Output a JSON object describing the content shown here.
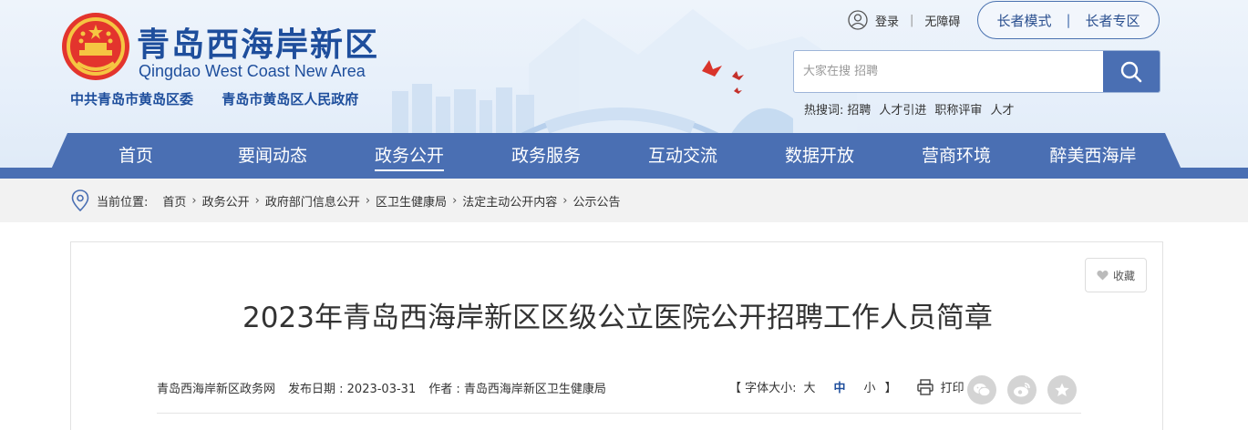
{
  "header": {
    "title": "青岛西海岸新区",
    "subtitle": "Qingdao West Coast New Area",
    "orgs": [
      "中共青岛市黄岛区委",
      "青岛市黄岛区人民政府"
    ],
    "login": "登录",
    "accessible": "无障碍",
    "elder_mode": "长者模式",
    "elder_zone": "长者专区"
  },
  "search": {
    "placeholder": "大家在搜 招聘",
    "hot_label": "热搜词:",
    "hot_words": [
      "招聘",
      "人才引进",
      "职称评审",
      "人才"
    ]
  },
  "nav": {
    "items": [
      "首页",
      "要闻动态",
      "政务公开",
      "政务服务",
      "互动交流",
      "数据开放",
      "营商环境",
      "醉美西海岸"
    ],
    "active": "政务公开"
  },
  "breadcrumb": {
    "label": "当前位置:",
    "items": [
      "首页",
      "政务公开",
      "政府部门信息公开",
      "区卫生健康局",
      "法定主动公开内容",
      "公示公告"
    ],
    "sep": "›"
  },
  "article": {
    "favorite": "收藏",
    "title": "2023年青岛西海岸新区区级公立医院公开招聘工作人员简章",
    "source": "青岛西海岸新区政务网",
    "date": "发布日期 : 2023-03-31",
    "author": "作者 : 青岛西海岸新区卫生健康局",
    "font_label": "【 字体大小:",
    "font_sizes": [
      "大",
      "中",
      "小"
    ],
    "font_close": "】",
    "print": "打印"
  },
  "colors": {
    "brand": "#1e4e9c",
    "nav": "#4a6fb3",
    "crumb_bg": "#f2f2f2"
  },
  "icons": [
    "emblem",
    "user-icon",
    "search-icon",
    "location-pin-icon",
    "heart-icon",
    "printer-icon",
    "wechat-icon",
    "weibo-icon",
    "star-icon"
  ]
}
